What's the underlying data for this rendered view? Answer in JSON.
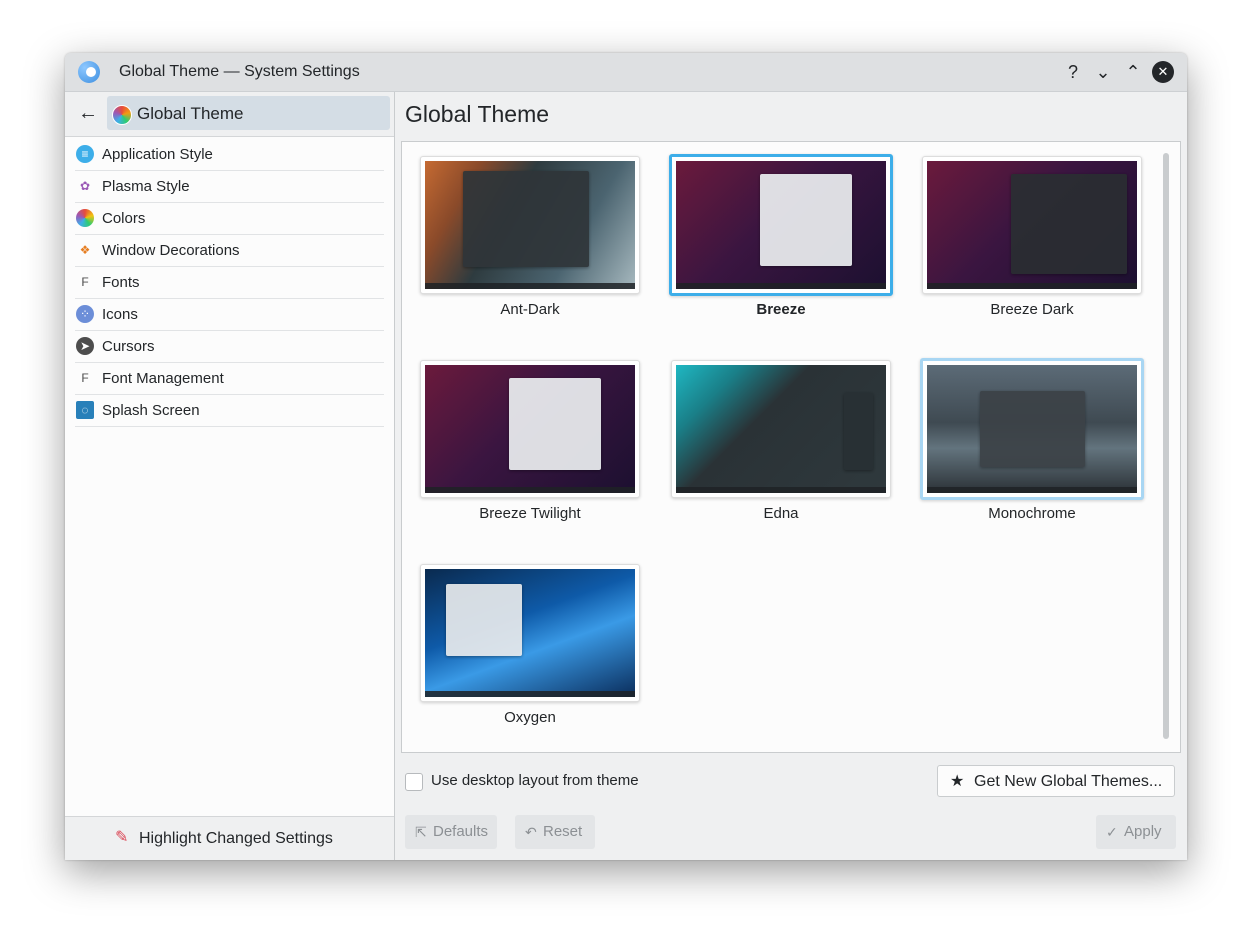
{
  "window": {
    "title": "Global Theme — System Settings",
    "help_label": "?",
    "minimize_label": "⌄",
    "maximize_label": "⌃",
    "close_label": "✕"
  },
  "sidebar": {
    "current_page": "Global Theme",
    "items": [
      {
        "label": "Application Style",
        "icon": "application-style-icon"
      },
      {
        "label": "Plasma Style",
        "icon": "plasma-style-icon"
      },
      {
        "label": "Colors",
        "icon": "colors-icon"
      },
      {
        "label": "Window Decorations",
        "icon": "window-decorations-icon"
      },
      {
        "label": "Fonts",
        "icon": "fonts-icon"
      },
      {
        "label": "Icons",
        "icon": "icons-icon"
      },
      {
        "label": "Cursors",
        "icon": "cursors-icon"
      },
      {
        "label": "Font Management",
        "icon": "font-management-icon"
      },
      {
        "label": "Splash Screen",
        "icon": "splash-screen-icon"
      }
    ],
    "highlight_label": "Highlight Changed Settings"
  },
  "main": {
    "title": "Global Theme",
    "themes": [
      {
        "name": "Ant-Dark",
        "state": "normal"
      },
      {
        "name": "Breeze",
        "state": "selected"
      },
      {
        "name": "Breeze Dark",
        "state": "normal"
      },
      {
        "name": "Breeze Twilight",
        "state": "normal"
      },
      {
        "name": "Edna",
        "state": "normal"
      },
      {
        "name": "Monochrome",
        "state": "hover"
      },
      {
        "name": "Oxygen",
        "state": "normal"
      }
    ],
    "use_desktop_layout_label": "Use desktop layout from theme",
    "use_desktop_layout_checked": false,
    "get_new_label": "Get New Global Themes...",
    "defaults_label": "Defaults",
    "reset_label": "Reset",
    "apply_label": "Apply"
  },
  "colors": {
    "accent": "#3daee9",
    "selected_sidebar_bg": "#d4dde5",
    "highlight_pen": "#da4453"
  }
}
